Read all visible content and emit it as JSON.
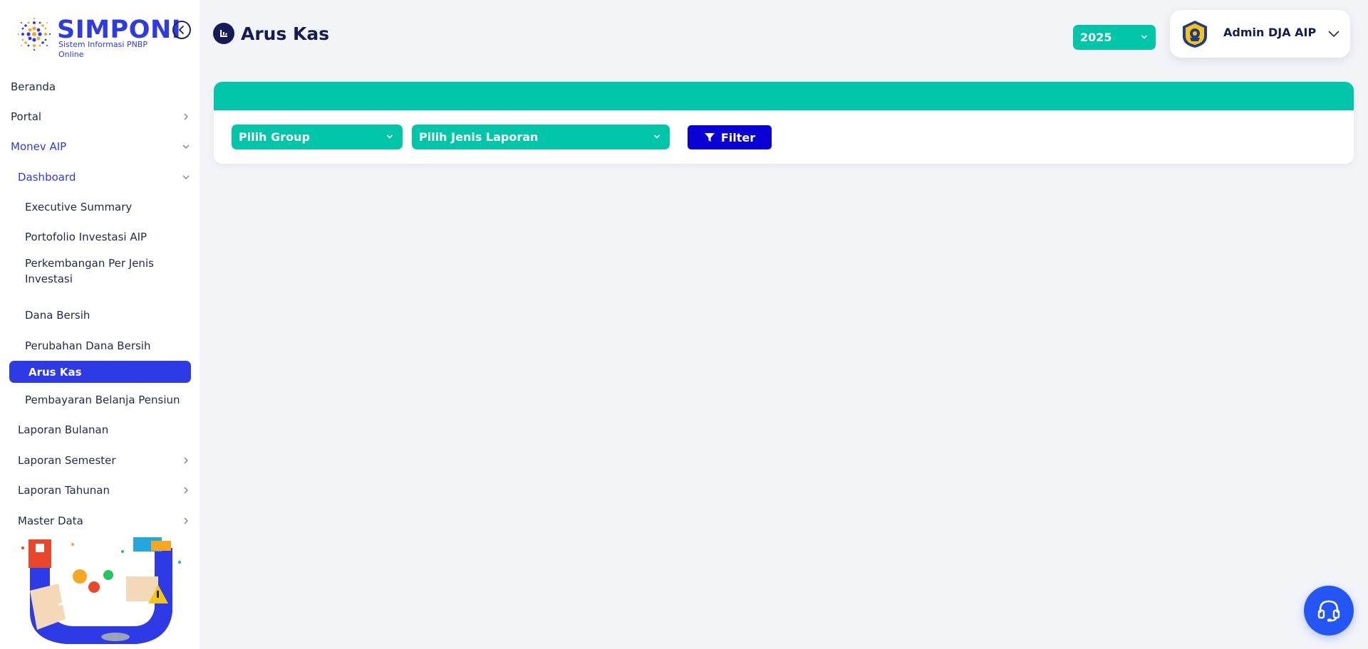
{
  "app": {
    "name": "SIMPONI",
    "subtitle": "Sistem Informasi PNBP Online"
  },
  "sidebar": {
    "items": [
      {
        "label": "Beranda",
        "level": 0,
        "icon": ""
      },
      {
        "label": "Portal",
        "level": 0,
        "icon": "chevron-right-icon"
      },
      {
        "label": "Monev AIP",
        "level": 0,
        "icon": "chevron-down-icon",
        "expanded": true
      },
      {
        "label": "Dashboard",
        "level": 1,
        "icon": "chevron-down-icon",
        "expanded": true
      },
      {
        "label": "Executive Summary",
        "level": 2
      },
      {
        "label": "Portofolio Investasi AIP",
        "level": 2
      },
      {
        "label": "Perkembangan Per Jenis",
        "label2": "Investasi",
        "level": 2
      },
      {
        "label": "Dana Bersih",
        "level": 2
      },
      {
        "label": "Perubahan Dana Bersih",
        "level": 2
      },
      {
        "label": "Arus Kas",
        "level": 2,
        "active": true
      },
      {
        "label": "Pembayaran Belanja Pensiun",
        "level": 2
      },
      {
        "label": "Laporan Bulanan",
        "level": 1
      },
      {
        "label": "Laporan Semester",
        "level": 1,
        "icon": "chevron-right-icon"
      },
      {
        "label": "Laporan Tahunan",
        "level": 1,
        "icon": "chevron-right-icon"
      },
      {
        "label": "Master Data",
        "level": 1,
        "icon": "chevron-right-icon"
      }
    ]
  },
  "header": {
    "page_title": "Arus Kas",
    "year": "2025",
    "user_name": "Admin DJA AIP"
  },
  "filters": {
    "group_placeholder": "Pilih Group",
    "report_placeholder": "Pilih Jenis Laporan",
    "filter_label": "Filter"
  },
  "colors": {
    "brand": "#2e3ae6",
    "teal": "#00c5a9",
    "filter_button": "#0a00d6",
    "title": "#141b55",
    "background": "#f3f4f8"
  }
}
